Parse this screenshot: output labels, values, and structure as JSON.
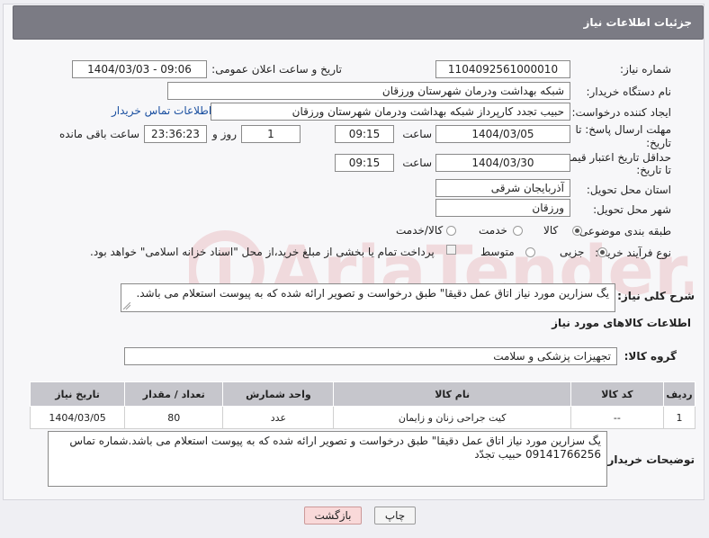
{
  "header": {
    "title": "جزئیات اطلاعات نیاز"
  },
  "fields": {
    "need_number_label": "شماره نیاز:",
    "need_number": "1104092561000010",
    "announce_label": "تاریخ و ساعت اعلان عمومی:",
    "announce_value": "1404/03/03 - 09:06",
    "buyer_org_label": "نام دستگاه خریدار:",
    "buyer_org": "شبکه بهداشت ودرمان شهرستان ورزقان",
    "creator_label": "ایجاد کننده درخواست:",
    "creator": "حبیب تجدد  کارپرداز شبکه بهداشت ودرمان شهرستان ورزقان",
    "buyer_contact_link": "اطلاعات تماس خریدار",
    "deadline_label_1": "مهلت ارسال پاسخ: تا",
    "deadline_label_2": "تاریخ:",
    "deadline_date": "1404/03/05",
    "time_label": "ساعت",
    "deadline_time": "09:15",
    "days_value": "1",
    "days_label": "روز و",
    "remaining_time": "23:36:23",
    "remaining_label": "ساعت باقی مانده",
    "price_label_1": "حداقل تاریخ اعتبار قیمت:",
    "price_label_2": "تا تاریخ:",
    "price_date": "1404/03/30",
    "price_time": "09:15",
    "province_label": "استان محل تحویل:",
    "province": "آذربایجان شرقی",
    "city_label": "شهر محل تحویل:",
    "city": "ورزقان",
    "category_label": "طبقه بندی موضوعی:",
    "category_options": [
      "کالا",
      "خدمت",
      "کالا/خدمت"
    ],
    "process_label": "نوع فرآیند خرید :",
    "process_options": [
      "جزیی",
      "متوسط"
    ],
    "payment_note": "پرداخت تمام یا بخشی از مبلغ خرید،از محل \"اسناد خزانه اسلامی\" خواهد بود."
  },
  "description": {
    "label": "شرح کلی نیاز:",
    "text": "یگ سزارین مورد نیاز اتاق عمل دقیقا\" طبق درخواست و تصویر ارائه شده که به پیوست استعلام می باشد."
  },
  "goods": {
    "section_title": "اطلاعات کالاهای مورد نیاز",
    "group_label": "گروه کالا:",
    "group_value": "تجهیزات پزشکی و سلامت",
    "columns": [
      "ردیف",
      "کد کالا",
      "نام کالا",
      "واحد شمارش",
      "تعداد / مقدار",
      "تاریخ نیاز"
    ],
    "rows": [
      [
        "1",
        "--",
        "کیت جراحی زنان و زایمان",
        "عدد",
        "80",
        "1404/03/05"
      ]
    ]
  },
  "buyer_notes": {
    "label": "توضیحات خریدار:",
    "text": "یگ سزارین مورد نیاز اتاق عمل دقیقا\" طبق درخواست و تصویر ارائه شده که به پیوست استعلام می باشد.شماره تماس 09141766256 حبیب تجدّد"
  },
  "buttons": {
    "print": "چاپ",
    "back": "بازگشت"
  },
  "watermark": {
    "text": "AriaTender.net",
    "color": "#c8202a"
  }
}
